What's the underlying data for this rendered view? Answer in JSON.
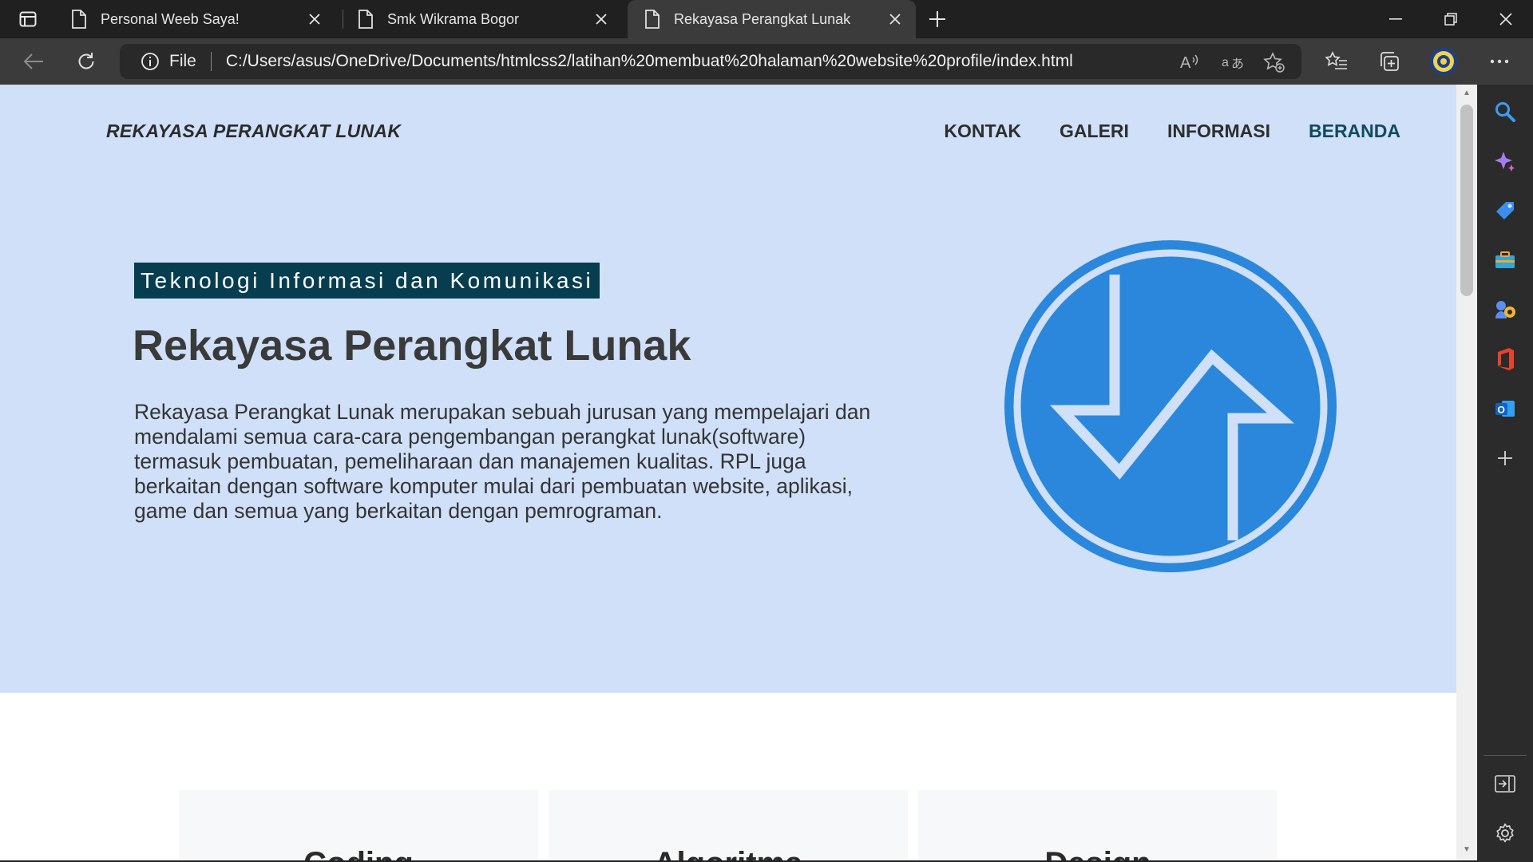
{
  "browser": {
    "tabs": [
      {
        "title": "Personal Weeb Saya!",
        "active": false
      },
      {
        "title": "Smk Wikrama Bogor",
        "active": false
      },
      {
        "title": "Rekayasa Perangkat Lunak",
        "active": true
      }
    ],
    "address": {
      "scheme_label": "File",
      "url": "C:/Users/asus/OneDrive/Documents/htmlcss2/latihan%20membuat%20halaman%20website%20profile/index.html"
    }
  },
  "page": {
    "brand": "REKAYASA PERANGKAT LUNAK",
    "nav": [
      "KONTAK",
      "GALERI",
      "INFORMASI",
      "BERANDA"
    ],
    "tag": "Teknologi Informasi dan Komunikasi",
    "headline": "Rekayasa Perangkat Lunak",
    "description": "Rekayasa Perangkat Lunak merupakan sebuah jurusan yang mempelajari dan mendalami semua cara-cara pengembangan perangkat lunak(software) termasuk pembuatan, pemeliharaan dan manajemen kualitas. RPL juga berkaitan dengan software komputer mulai dari pembuatan website, aplikasi, game dan semua yang berkaitan dengan pemrograman.",
    "cards": [
      "Coding",
      "Algoritma",
      "Design"
    ]
  },
  "colors": {
    "hero_bg": "#cfe0f8",
    "tag_bg": "#063d4f",
    "logo_blue": "#2a87db",
    "active_nav": "#124a5e"
  },
  "icons": {
    "tab_actions": "tab-actions-icon",
    "document": "document-icon",
    "back": "back-arrow-icon",
    "reload": "reload-icon",
    "info": "info-icon",
    "read_aloud": "read-aloud-icon",
    "translate": "translate-icon",
    "favorite_add": "add-favorite-icon",
    "favorites": "favorites-icon",
    "collections": "collections-icon",
    "profile": "profile-avatar",
    "more": "more-icon"
  }
}
